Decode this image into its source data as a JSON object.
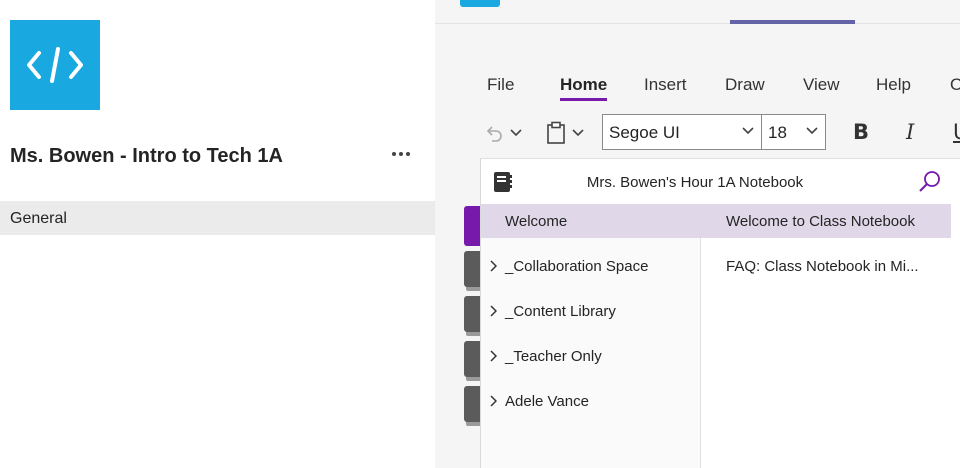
{
  "team": {
    "name": "Ms. Bowen - Intro to Tech 1A",
    "logo_icon": "code-icon",
    "logo_color": "#1aa8e0",
    "channels": [
      {
        "label": "General",
        "selected": true
      }
    ]
  },
  "ribbon": {
    "tabs": [
      {
        "label": "File"
      },
      {
        "label": "Home",
        "active": true
      },
      {
        "label": "Insert"
      },
      {
        "label": "Draw"
      },
      {
        "label": "View"
      },
      {
        "label": "Help"
      },
      {
        "label": "O"
      }
    ],
    "font_name": "Segoe UI",
    "font_size": "18",
    "bold_label": "B",
    "italic_label": "I",
    "underline_label": "U",
    "accent": "#7719aa"
  },
  "notebook": {
    "title": "Mrs. Bowen's Hour 1A Notebook",
    "sections": [
      {
        "label": "Welcome",
        "selected": true,
        "expandable": false
      },
      {
        "label": "_Collaboration Space",
        "expandable": true
      },
      {
        "label": "_Content Library",
        "expandable": true
      },
      {
        "label": "_Teacher Only",
        "expandable": true
      },
      {
        "label": "Adele Vance",
        "expandable": true
      }
    ],
    "pages": [
      {
        "label": "Welcome to Class Notebook",
        "selected": true
      },
      {
        "label": "FAQ: Class Notebook in Mi..."
      }
    ]
  }
}
